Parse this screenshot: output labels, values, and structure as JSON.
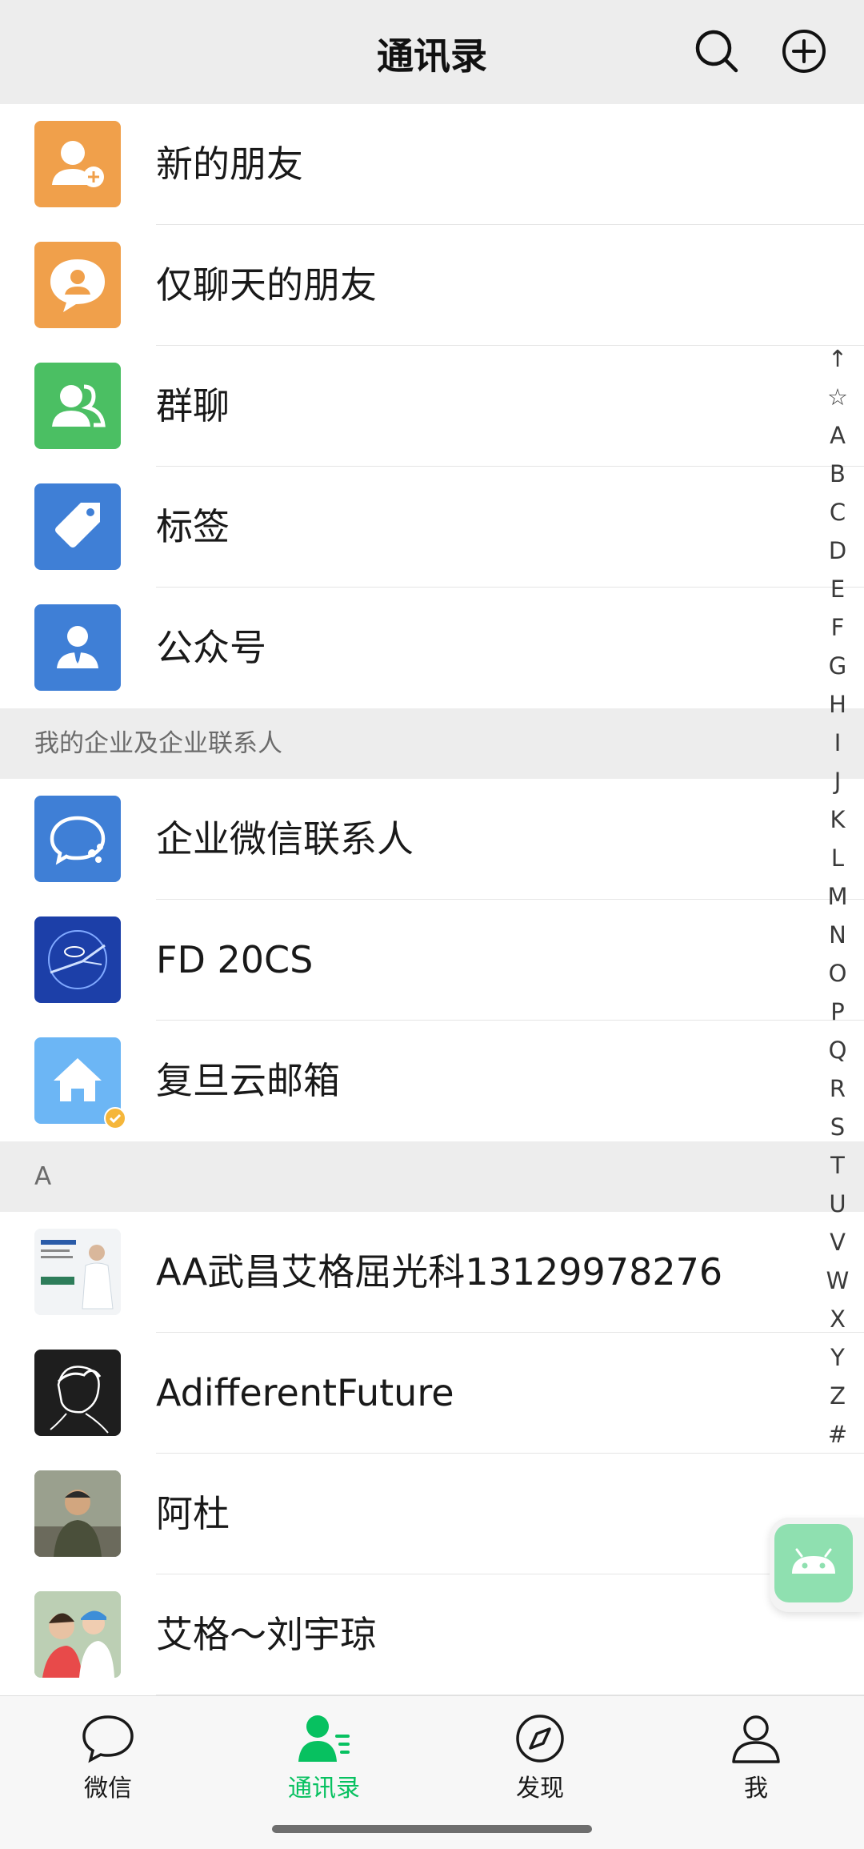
{
  "header": {
    "title": "通讯录"
  },
  "top_items": [
    {
      "label": "新的朋友",
      "icon": "add-friend-icon",
      "color": "#f0a04b"
    },
    {
      "label": "仅聊天的朋友",
      "icon": "chat-only-friend-icon",
      "color": "#f0a04b"
    },
    {
      "label": "群聊",
      "icon": "group-chat-icon",
      "color": "#4bbf63"
    },
    {
      "label": "标签",
      "icon": "tag-icon",
      "color": "#3f7fd6"
    },
    {
      "label": "公众号",
      "icon": "official-account-icon",
      "color": "#3f7fd6"
    }
  ],
  "enterprise_section": {
    "title": "我的企业及企业联系人",
    "items": [
      {
        "label": "企业微信联系人",
        "icon": "wecom-contacts-icon",
        "color": "#3f7fd6"
      },
      {
        "label": "FD 20CS",
        "icon": "fd-20cs-avatar",
        "color": "#1c3fa8"
      },
      {
        "label": "复旦云邮箱",
        "icon": "home-icon",
        "color": "#6cb6f5"
      }
    ]
  },
  "section_a": {
    "title": "A",
    "contacts": [
      {
        "label": "AA武昌艾格屈光科13129978276",
        "icon": "doctor-photo-avatar"
      },
      {
        "label": "AdifferentFuture",
        "icon": "sketch-portrait-avatar"
      },
      {
        "label": "阿杜",
        "icon": "person-photo-avatar"
      },
      {
        "label": "艾格～刘宇琼",
        "icon": "family-photo-avatar"
      }
    ]
  },
  "index_bar": [
    "↑",
    "☆",
    "A",
    "B",
    "C",
    "D",
    "E",
    "F",
    "G",
    "H",
    "I",
    "J",
    "K",
    "L",
    "M",
    "N",
    "O",
    "P",
    "Q",
    "R",
    "S",
    "T",
    "U",
    "V",
    "W",
    "X",
    "Y",
    "Z",
    "#"
  ],
  "tabbar": {
    "tabs": [
      {
        "label": "微信",
        "icon": "chat-bubble-icon"
      },
      {
        "label": "通讯录",
        "icon": "contacts-icon",
        "active": true
      },
      {
        "label": "发现",
        "icon": "compass-icon"
      },
      {
        "label": "我",
        "icon": "person-icon"
      }
    ]
  },
  "colors": {
    "accent": "#07c160",
    "header_bg": "#ededed"
  }
}
